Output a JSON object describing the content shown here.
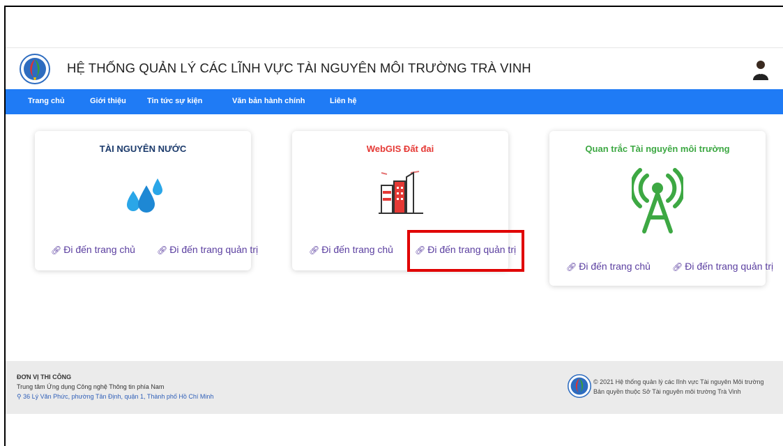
{
  "header": {
    "title": "HỆ THỐNG QUẢN LÝ CÁC LĨNH VỰC TÀI NGUYÊN MÔI TRƯỜNG TRÀ VINH",
    "logo_icon": "department-seal-icon",
    "avatar_icon": "user-avatar-icon"
  },
  "nav": {
    "items": [
      "Trang chủ",
      "Giới thiệu",
      "Tin tức sự kiện",
      "Văn bản hành chính",
      "Liên hệ"
    ],
    "background": "#1f7bf5"
  },
  "cards": [
    {
      "title": "TÀI NGUYÊN NƯỚC",
      "title_color": "#1b3a6b",
      "icon": "water-drops-icon",
      "link_home": "Đi đến trang chủ",
      "link_admin": "Đi đến trang quản trị"
    },
    {
      "title": "WebGIS Đất đai",
      "title_color": "#e53935",
      "icon": "city-buildings-icon",
      "link_home": "Đi đến trang chủ",
      "link_admin": "Đi đến trang quản trị"
    },
    {
      "title": "Quan trắc Tài nguyên môi trường",
      "title_color": "#3da843",
      "icon": "radio-tower-icon",
      "link_home": "Đi đến trang chủ",
      "link_admin": "Đi đến trang quản trị"
    }
  ],
  "footer": {
    "heading": "ĐƠN VỊ THI CÔNG",
    "org": "Trung tâm Ứng dụng Công nghệ Thông tin phía Nam",
    "address": "36 Lý Văn Phức, phường Tân Định, quận 1, Thành phố Hồ Chí Minh",
    "copyright": "© 2021 Hệ thống quản lý các lĩnh vực Tài nguyên Môi trường",
    "rights": "Bản quyền thuộc Sở Tài nguyên môi trường Trà Vinh"
  },
  "colors": {
    "highlight": "#e00000",
    "link": "#5b3fa0"
  }
}
